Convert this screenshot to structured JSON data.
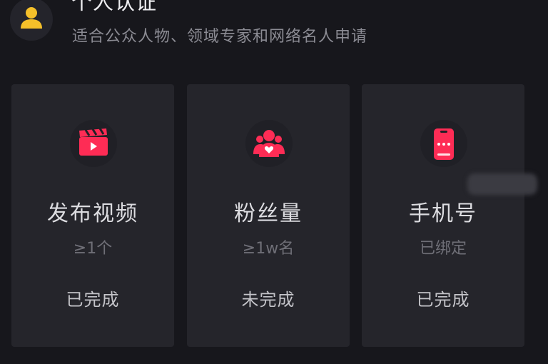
{
  "header": {
    "title": "个人认证",
    "subtitle": "适合公众人物、领域专家和网络名人申请",
    "avatar_icon": "user-icon"
  },
  "cards": [
    {
      "icon": "video-clapper-icon",
      "title": "发布视频",
      "requirement": "≥1个",
      "status": "已完成"
    },
    {
      "icon": "fans-group-icon",
      "title": "粉丝量",
      "requirement": "≥1w名",
      "status": "未完成"
    },
    {
      "icon": "phone-icon",
      "title": "手机号",
      "requirement": "已绑定",
      "status": "已完成"
    }
  ],
  "colors": {
    "accent": "#fe2c55",
    "avatar_yellow": "#f5c02a",
    "background": "#17171c",
    "card": "#25252b"
  }
}
